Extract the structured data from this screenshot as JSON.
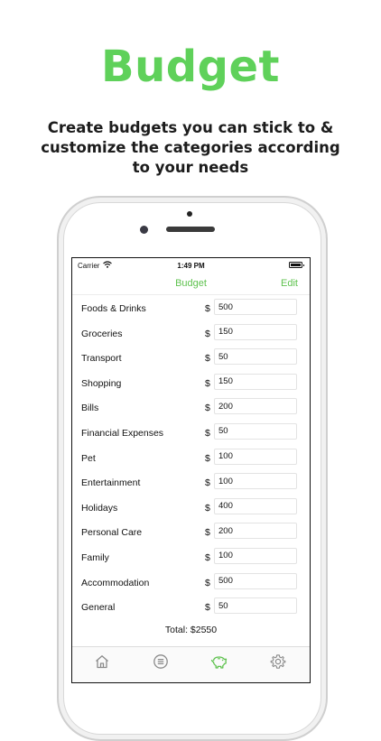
{
  "promo": {
    "headline": "Budget",
    "tagline": "Create budgets you can stick to & customize the categories according to your needs"
  },
  "colors": {
    "accent": "#5fd15a",
    "nav_accent": "#5fc24f",
    "tab_active": "#5fc24f",
    "tab_inactive": "#8a8a8a"
  },
  "statusbar": {
    "carrier": "Carrier",
    "time": "1:49 PM"
  },
  "navbar": {
    "title": "Budget",
    "edit_label": "Edit"
  },
  "budget": {
    "currency_symbol": "$",
    "categories": [
      {
        "label": "Foods & Drinks",
        "value": "500"
      },
      {
        "label": "Groceries",
        "value": "150"
      },
      {
        "label": "Transport",
        "value": "50"
      },
      {
        "label": "Shopping",
        "value": "150"
      },
      {
        "label": "Bills",
        "value": "200"
      },
      {
        "label": "Financial Expenses",
        "value": "50"
      },
      {
        "label": "Pet",
        "value": "100"
      },
      {
        "label": "Entertainment",
        "value": "100"
      },
      {
        "label": "Holidays",
        "value": "400"
      },
      {
        "label": "Personal Care",
        "value": "200"
      },
      {
        "label": "Family",
        "value": "100"
      },
      {
        "label": "Accommodation",
        "value": "500"
      },
      {
        "label": "General",
        "value": "50"
      }
    ],
    "total": "Total: $2550"
  },
  "tabbar": {
    "items": [
      {
        "icon": "home-icon",
        "active": false
      },
      {
        "icon": "list-icon",
        "active": false
      },
      {
        "icon": "piggy-bank-icon",
        "active": true
      },
      {
        "icon": "gear-icon",
        "active": false
      }
    ]
  }
}
